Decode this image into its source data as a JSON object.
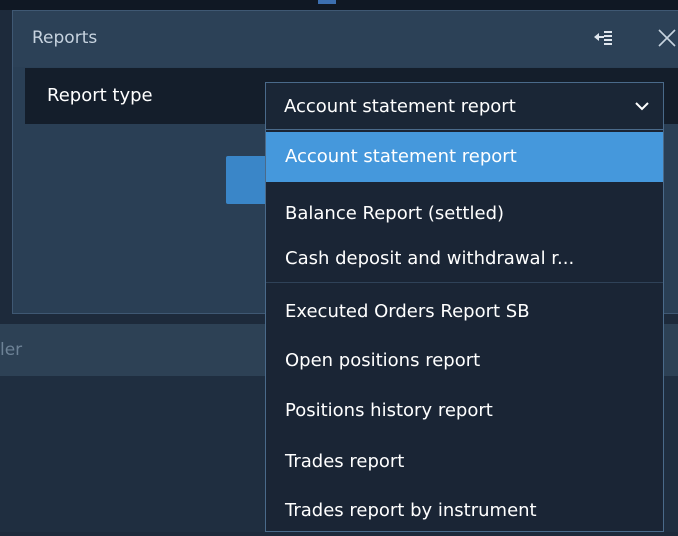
{
  "window": {
    "title": "Reports"
  },
  "form": {
    "report_type_label": "Report type"
  },
  "select": {
    "value": "Account statement report",
    "options": [
      "Account statement report",
      "Balance Report (settled)",
      "Cash deposit and withdrawal r...",
      "Executed Orders Report SB",
      "Open positions report",
      "Positions history report",
      "Trades report",
      "Trades report by instrument"
    ],
    "selected_index": 0
  },
  "background_panel": {
    "title_fragment": "ler"
  },
  "icons": {
    "pin": "pin-panel-icon",
    "close": "close-icon",
    "dropdown": "chevron-down-icon"
  },
  "colors": {
    "selected": "#4598dc",
    "background": "#1d2a3b",
    "input_border": "#4a6a8a"
  }
}
